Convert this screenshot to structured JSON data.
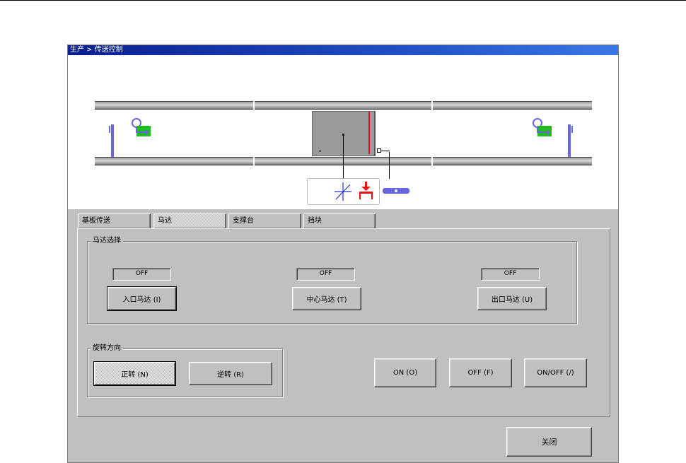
{
  "window": {
    "title": "生产 > 传送控制"
  },
  "tabs": [
    {
      "label": "基板传送"
    },
    {
      "label": "马达"
    },
    {
      "label": "支撑台"
    },
    {
      "label": "挡块"
    }
  ],
  "motor_select": {
    "legend": "马达选择",
    "status": [
      "OFF",
      "OFF",
      "OFF"
    ],
    "buttons": [
      {
        "label": "入口马达 (I)"
      },
      {
        "label": "中心马达 (T)"
      },
      {
        "label": "出口马达 (U)"
      }
    ]
  },
  "rotation": {
    "legend": "旋转方向",
    "forward_label": "正转 (N)",
    "reverse_label": "逆转 (R)"
  },
  "actions": {
    "on_label": "ON (O)",
    "off_label": "OFF (F)",
    "onoff_label": "ON/OFF (/)"
  },
  "close_label": "关闭",
  "colors": {
    "title_bar": "#0a1e8c",
    "sensor": "#6666dd",
    "board": "#22bb22",
    "stopper": "#ee1111"
  }
}
